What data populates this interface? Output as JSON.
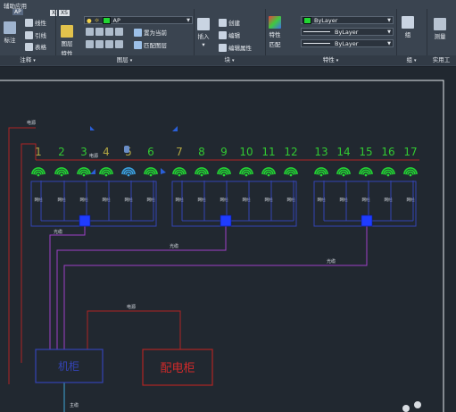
{
  "ribbon": {
    "app_title": "辅助应用",
    "quick_badges": [
      "AP",
      "X",
      "XS"
    ],
    "annotation": {
      "label": "注释",
      "big_button": "标注",
      "items": [
        "线性",
        "引线",
        "表格"
      ]
    },
    "layers": {
      "label": "图层",
      "big_button_1": "图层",
      "big_button_1b": "特性",
      "current_layer": "AP",
      "items": [
        "置为当前",
        "匹配图层"
      ]
    },
    "block": {
      "label": "块",
      "big_button": "插入",
      "items": [
        "创建",
        "编辑",
        "编辑属性"
      ]
    },
    "properties": {
      "label": "特性",
      "big_button_1": "特性",
      "big_button_2": "匹配",
      "color_value": "ByLayer",
      "linetype_value": "ByLayer",
      "lineweight_value": "ByLayer"
    },
    "groups": {
      "label": "组",
      "big_button": "组"
    },
    "utilities": {
      "label": "实用工",
      "big_button": "测量"
    }
  },
  "drawing": {
    "numbers": [
      "1",
      "2",
      "3",
      "4",
      "5",
      "6",
      "7",
      "8",
      "9",
      "10",
      "11",
      "12",
      "13",
      "14",
      "15",
      "16",
      "17"
    ],
    "labels": {
      "power_top": "电源",
      "power_main": "电源",
      "ap_line": "电源",
      "cabinet": "机柜",
      "distribution": "配电柜",
      "fiber": "光缆",
      "trunk": "主缆",
      "network": "网线"
    }
  },
  "colors": {
    "accent_blue": "#2a5fd8",
    "wifi_green": "#22d633",
    "number_green": "#32c832",
    "dark_red": "#b02424",
    "purple": "#a040c8",
    "navy": "#3444b4"
  }
}
